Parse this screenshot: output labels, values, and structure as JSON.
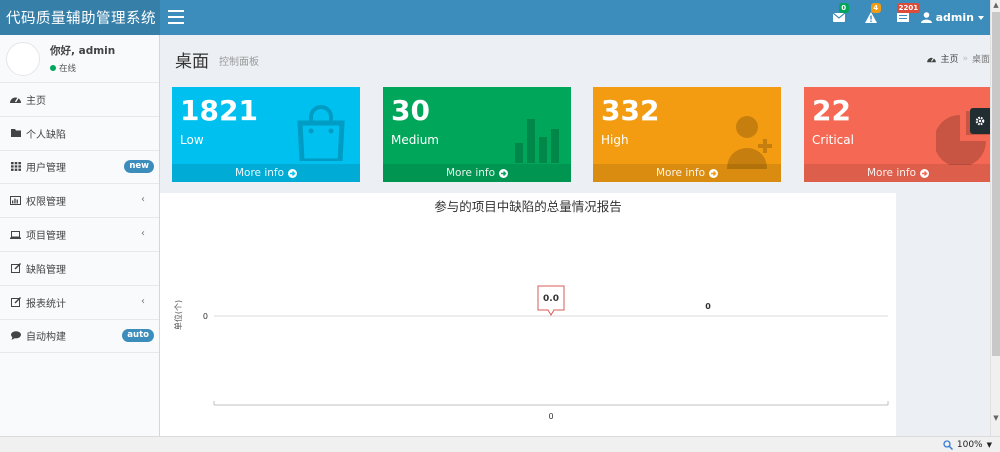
{
  "app": {
    "title": "代码质量辅助管理系统"
  },
  "navbar": {
    "mail_badge": "0",
    "mail_badge_color": "#00a65a",
    "warning_badge": "4",
    "warning_badge_color": "#f39c12",
    "tasks_badge": "2201",
    "tasks_badge_color": "#dd4b39",
    "user": "admin"
  },
  "sidebar": {
    "user_greeting": "你好, admin",
    "user_status": "在线",
    "items": [
      {
        "label": "主页",
        "icon": "dashboard-icon"
      },
      {
        "label": "个人缺陷",
        "icon": "folder-icon"
      },
      {
        "label": "用户管理",
        "icon": "grid-icon",
        "badge": "new"
      },
      {
        "label": "权限管理",
        "icon": "bar-chart-icon"
      },
      {
        "label": "项目管理",
        "icon": "laptop-icon"
      },
      {
        "label": "缺陷管理",
        "icon": "edit-icon"
      },
      {
        "label": "报表统计",
        "icon": "edit-icon"
      },
      {
        "label": "自动构建",
        "icon": "comment-icon",
        "badge": "auto"
      }
    ]
  },
  "content": {
    "title": "桌面",
    "subtitle": "控制面板",
    "breadcrumb": {
      "home": "主页",
      "current": "桌面"
    }
  },
  "boxes": [
    {
      "value": "1821",
      "label": "Low",
      "footer": "More info",
      "color": "#00c0ef",
      "icon": "shopping-bag-icon"
    },
    {
      "value": "30",
      "label": "Medium",
      "footer": "More info",
      "color": "#00a65a",
      "icon": "bar-chart-icon"
    },
    {
      "value": "332",
      "label": "High",
      "footer": "More info",
      "color": "#f39c12",
      "icon": "user-plus-icon"
    },
    {
      "value": "22",
      "label": "Critical",
      "footer": "More info",
      "color": "#f56954",
      "icon": "pie-chart-icon"
    }
  ],
  "chart_data": {
    "type": "bar",
    "title": "参与的项目中缺陷的总量情况报告",
    "ylabel": "单位(个)",
    "xlabel": "",
    "categories": [
      "0"
    ],
    "y_ticks": [
      "0"
    ],
    "series": [
      {
        "values": [
          0
        ]
      }
    ],
    "data_label": "0",
    "tooltip": "0.0",
    "grid": true
  },
  "statusbar": {
    "zoom": "100%"
  }
}
